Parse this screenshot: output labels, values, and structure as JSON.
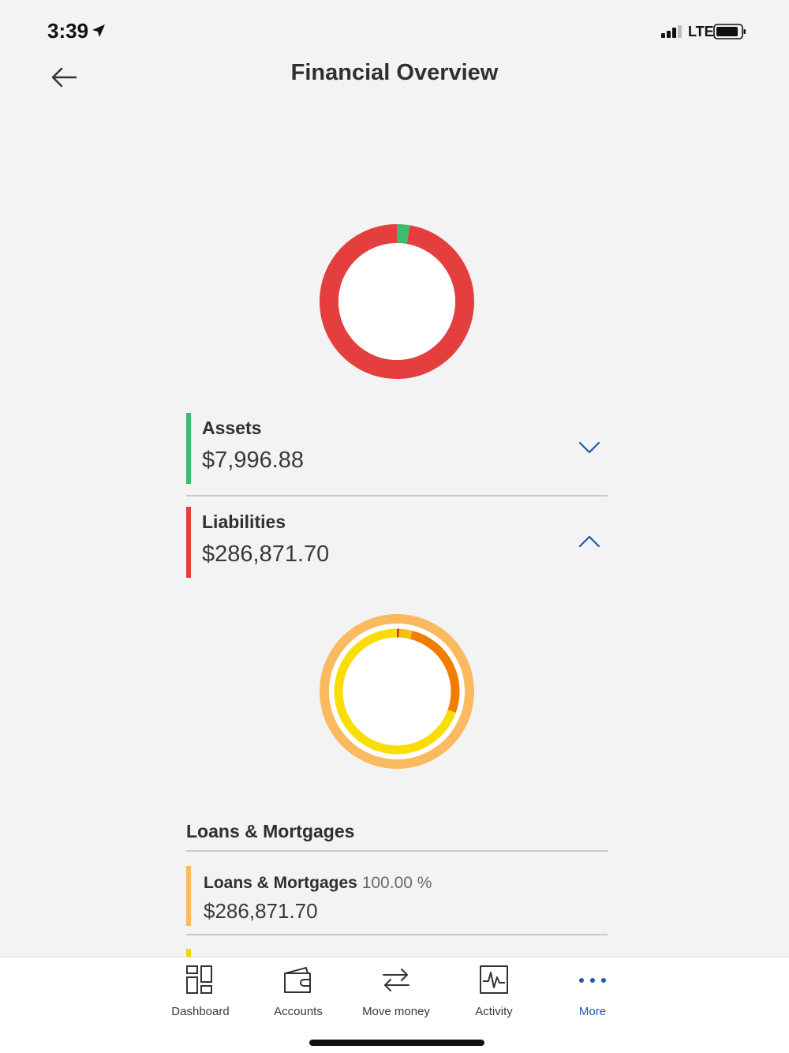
{
  "status_bar": {
    "time": "3:39",
    "network": "LTE"
  },
  "header": {
    "title": "Financial Overview"
  },
  "overview_chart": {
    "segments": [
      {
        "name": "Assets",
        "value": 7996.88,
        "color": "#3dbb6e"
      },
      {
        "name": "Liabilities",
        "value": 286871.7,
        "color": "#e53e3e"
      }
    ]
  },
  "summary": {
    "assets": {
      "label": "Assets",
      "amount": "$7,996.88",
      "color": "#3dbb6e",
      "expanded": false
    },
    "liabilities": {
      "label": "Liabilities",
      "amount": "$286,871.70",
      "color": "#e53e3e",
      "expanded": true
    }
  },
  "liabilities_chart": {
    "outer_ring": {
      "name": "Loans & Mortgages",
      "percent": 100.0,
      "color": "#fbb960"
    },
    "inner_ring": [
      {
        "percent": 0.6,
        "color": "#d9391a"
      },
      {
        "percent": 3.4,
        "color": "#f4c20d"
      },
      {
        "percent": 26.5,
        "color": "#ee7d00"
      },
      {
        "percent": 69.5,
        "color": "#f9dd05"
      }
    ]
  },
  "breakdown": {
    "heading": "Loans & Mortgages",
    "items": [
      {
        "name": "Loans & Mortgages",
        "percent": "100.00 %",
        "amount": "$286,871.70",
        "color": "#fbb960"
      }
    ]
  },
  "tabbar": {
    "accent": "#1f5aa6",
    "tabs": [
      {
        "label": "Dashboard",
        "icon": "dashboard-icon"
      },
      {
        "label": "Accounts",
        "icon": "wallet-icon"
      },
      {
        "label": "Move money",
        "icon": "transfer-arrows-icon"
      },
      {
        "label": "Activity",
        "icon": "activity-chart-icon"
      },
      {
        "label": "More",
        "icon": "more-dots-icon",
        "active": true
      }
    ]
  }
}
